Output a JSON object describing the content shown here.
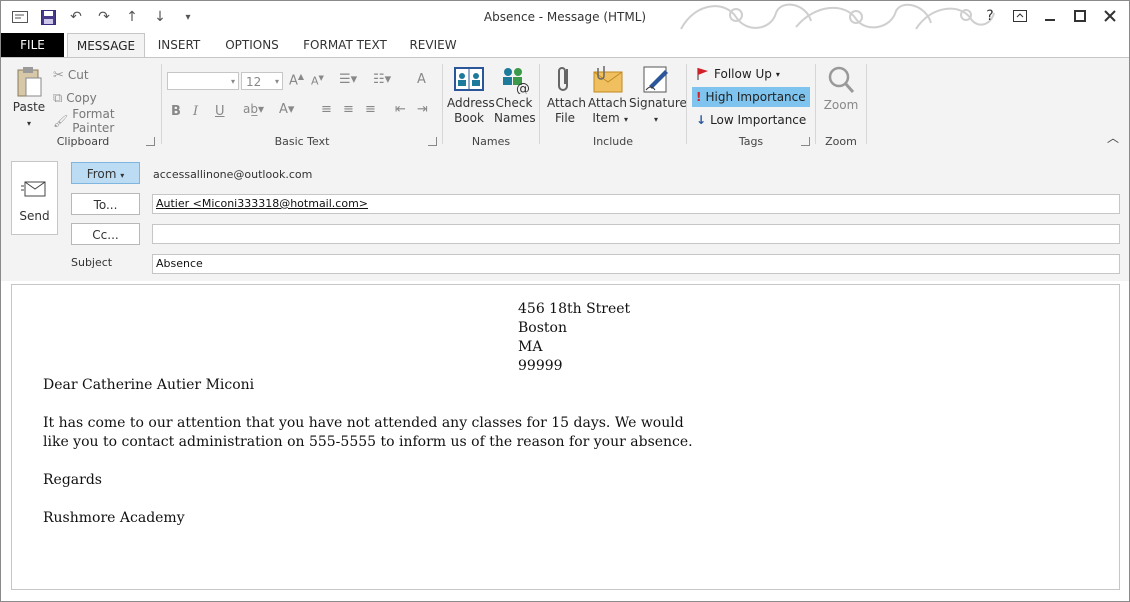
{
  "window": {
    "title": "Absence - Message (HTML)"
  },
  "tabs": [
    "FILE",
    "MESSAGE",
    "INSERT",
    "OPTIONS",
    "FORMAT TEXT",
    "REVIEW"
  ],
  "ribbon": {
    "clipboard": {
      "paste": "Paste",
      "cut": "Cut",
      "copy": "Copy",
      "format_painter": "Format Painter",
      "label": "Clipboard"
    },
    "basic_text": {
      "font_size": "12",
      "bold": "B",
      "italic": "I",
      "underline": "U",
      "label": "Basic Text"
    },
    "names": {
      "address_book": "Address Book",
      "check_names": "Check Names",
      "label": "Names"
    },
    "include": {
      "attach_file": "Attach File",
      "attach_item": "Attach Item",
      "signature": "Signature",
      "label": "Include"
    },
    "tags": {
      "follow_up": "Follow Up",
      "high_importance": "High Importance",
      "low_importance": "Low Importance",
      "label": "Tags"
    },
    "zoom": {
      "zoom": "Zoom",
      "label": "Zoom"
    }
  },
  "header": {
    "send": "Send",
    "from_label": "From",
    "from_value": "accessallinone@outlook.com",
    "to_label": "To...",
    "to_value": "Autier <Miconi333318@hotmail.com>",
    "cc_label": "Cc...",
    "cc_value": "",
    "subject_label": "Subject",
    "subject_value": "Absence"
  },
  "body": {
    "address": [
      "456 18th Street",
      "Boston",
      "MA",
      "99999"
    ],
    "greeting": "Dear Catherine Autier Miconi",
    "paragraph": "It has come to our attention that you have not attended any classes for 15 days. We would like you to contact administration on 555-5555 to inform us of the reason for your absence.",
    "closing": "Regards",
    "signature": "Rushmore Academy"
  },
  "colors": {
    "accent": "#2b579a",
    "selected_highlight": "#7fc4ee",
    "file_tab": "#000000"
  }
}
